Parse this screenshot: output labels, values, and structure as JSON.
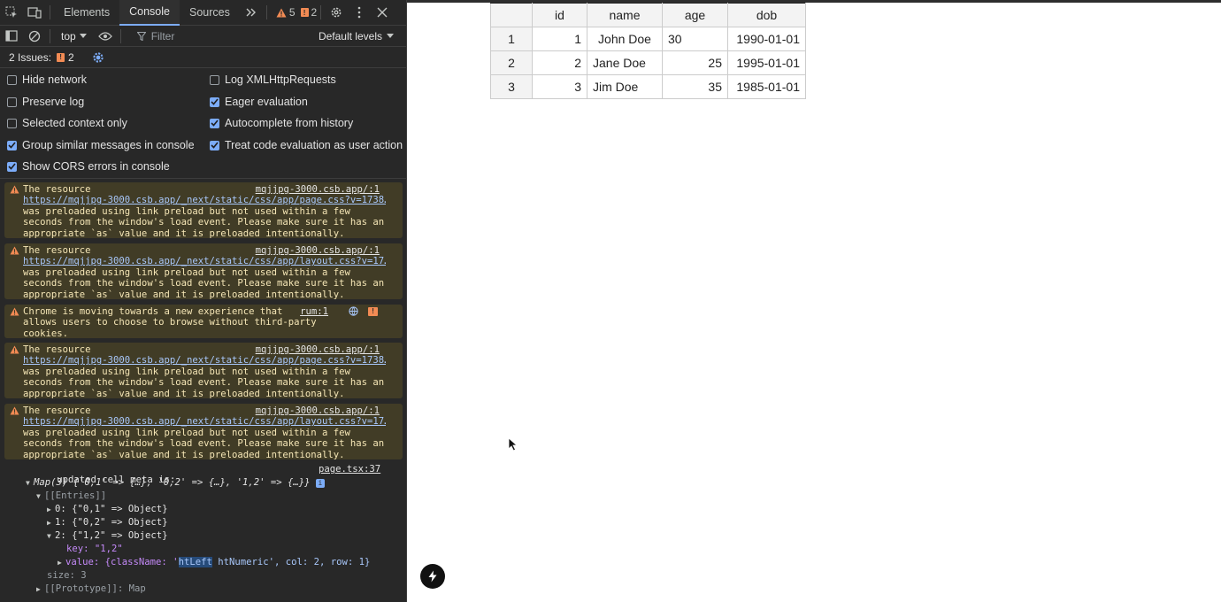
{
  "devtools": {
    "tabs": [
      {
        "label": "Elements",
        "active": false
      },
      {
        "label": "Console",
        "active": true
      },
      {
        "label": "Sources",
        "active": false
      }
    ],
    "warning_count": "5",
    "issue_count": "2",
    "toolbar": {
      "context": "top",
      "filter_placeholder": "Filter",
      "levels": "Default levels"
    },
    "issues_bar": {
      "label": "2 Issues:",
      "count": "2"
    },
    "settings": {
      "left": [
        {
          "label": "Hide network",
          "checked": false
        },
        {
          "label": "Preserve log",
          "checked": false
        },
        {
          "label": "Selected context only",
          "checked": false
        },
        {
          "label": "Group similar messages in console",
          "checked": true
        },
        {
          "label": "Show CORS errors in console",
          "checked": true
        }
      ],
      "right": [
        {
          "label": "Log XMLHttpRequests",
          "checked": false
        },
        {
          "label": "Eager evaluation",
          "checked": true
        },
        {
          "label": "Autocomplete from history",
          "checked": true
        },
        {
          "label": "Treat code evaluation as user action",
          "checked": true
        }
      ]
    },
    "messages": [
      {
        "line1": "The resource",
        "source": "mqjjpg-3000.csb.app/:1",
        "url": "https://mqjjpg-3000.csb.app/_next/static/css/app/page.css?v=1738…",
        "rest": "was preloaded using link preload but not used within a few\nseconds from the window's load event. Please make sure it has an\nappropriate `as` value and it is preloaded intentionally."
      },
      {
        "line1": "The resource",
        "source": "mqjjpg-3000.csb.app/:1",
        "url": "https://mqjjpg-3000.csb.app/_next/static/css/app/layout.css?v=17…",
        "rest": "was preloaded using link preload but not used within a few\nseconds from the window's load event. Please make sure it has an\nappropriate `as` value and it is preloaded intentionally."
      },
      {
        "line1": "Chrome is moving towards a new experience that\nallows users to choose to browse without third-party\ncookies.",
        "source": "rum:1"
      },
      {
        "line1": "The resource",
        "source": "mqjjpg-3000.csb.app/:1",
        "url": "https://mqjjpg-3000.csb.app/_next/static/css/app/page.css?v=1738…",
        "rest": "was preloaded using link preload but not used within a few\nseconds from the window's load event. Please make sure it has an\nappropriate `as` value and it is preloaded intentionally."
      },
      {
        "line1": "The resource",
        "source": "mqjjpg-3000.csb.app/:1",
        "url": "https://mqjjpg-3000.csb.app/_next/static/css/app/layout.css?v=17…",
        "rest": "was preloaded using link preload but not used within a few\nseconds from the window's load event. Please make sure it has an\nappropriate `as` value and it is preloaded intentionally."
      }
    ],
    "log": {
      "text": "updated cell meta is:",
      "source": "page.tsx:37",
      "map_summary": "Map(3) {'0,1' => {…}, '0,2' => {…}, '1,2' => {…}}",
      "entries_label": "[[Entries]]",
      "entry0": "0: {\"0,1\" => Object}",
      "entry1": "1: {\"0,2\" => Object}",
      "entry2": "2: {\"1,2\" => Object}",
      "key_line": "key: \"1,2\"",
      "value_line_prefix": "value: {className: '",
      "value_highlight": "htLeft",
      "value_line_suffix": " htNumeric', col: 2, row: 1}",
      "size_line": "size: 3",
      "proto_line": "[[Prototype]]: Map"
    }
  },
  "table": {
    "headers": [
      "",
      "id",
      "name",
      "age",
      "dob"
    ],
    "rows": [
      {
        "rowh": "1",
        "id": "1",
        "name": "John Doe",
        "age": "30",
        "dob": "1990-01-01"
      },
      {
        "rowh": "2",
        "id": "2",
        "name": "Jane Doe",
        "age": "25",
        "dob": "1995-01-01"
      },
      {
        "rowh": "3",
        "id": "3",
        "name": "Jim Doe",
        "age": "35",
        "dob": "1985-01-01"
      }
    ]
  },
  "colors": {
    "devtools_bg": "#282828",
    "warning_bg": "#413c26",
    "accent": "#7cacf8",
    "warning_icon": "#f28b54"
  }
}
